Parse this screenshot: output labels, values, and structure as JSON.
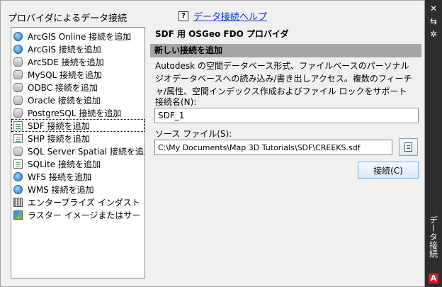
{
  "header": {
    "providers_label": "プロバイダによるデータ接続",
    "help_icon": "?",
    "help_link": "データ接続ヘルプ"
  },
  "providers": [
    {
      "label": "ArcGIS Online 接続を追加",
      "icon": "globe-icon"
    },
    {
      "label": "ArcGIS 接続を追加",
      "icon": "globe-icon"
    },
    {
      "label": "ArcSDE 接続を追加",
      "icon": "database-icon"
    },
    {
      "label": "MySQL 接続を追加",
      "icon": "database-icon"
    },
    {
      "label": "ODBC 接続を追加",
      "icon": "database-icon"
    },
    {
      "label": "Oracle 接続を追加",
      "icon": "database-icon"
    },
    {
      "label": "PostgreSQL 接続を追加",
      "icon": "database-icon"
    },
    {
      "label": "SDF 接続を追加",
      "icon": "file-icon",
      "selected": true
    },
    {
      "label": "SHP 接続を追加",
      "icon": "file-icon"
    },
    {
      "label": "SQL Server Spatial 接続を追加",
      "icon": "database-icon"
    },
    {
      "label": "SQLite 接続を追加",
      "icon": "file-icon"
    },
    {
      "label": "WFS 接続を追加",
      "icon": "globe-icon"
    },
    {
      "label": "WMS 接続を追加",
      "icon": "globe-icon"
    },
    {
      "label": "エンタープライズ インダスト",
      "icon": "grid-icon"
    },
    {
      "label": "ラスター イメージまたはサー",
      "icon": "image-icon"
    }
  ],
  "panel": {
    "provider_title": "SDF 用 OSGeo FDO プロバイダ",
    "section_title": "新しい接続を追加",
    "description": "Autodesk の空間データベース形式、ファイルベースのパーソナル ジオデータベースへの読み込み/書き出しアクセス。複数のフィーチャ/属性、空間インデックス作成およびファイル ロックをサポート",
    "name_label": "接続名(N):",
    "name_value": "SDF_1",
    "source_label": "ソース ファイル(S):",
    "source_value": "C:\\My Documents\\Map 3D Tutorials\\SDF\\CREEKS.sdf",
    "connect_label": "接続(C)"
  },
  "palette": {
    "close_glyph": "✕",
    "autohide_glyph": "⇆",
    "menu_glyph": "✲",
    "title": "データ接続",
    "logo": "A"
  },
  "colors": {
    "section_bar": "#a5a5a5",
    "palette_bar": "#2d2d2d",
    "link": "#0033cc",
    "logo_red": "#d32026"
  }
}
